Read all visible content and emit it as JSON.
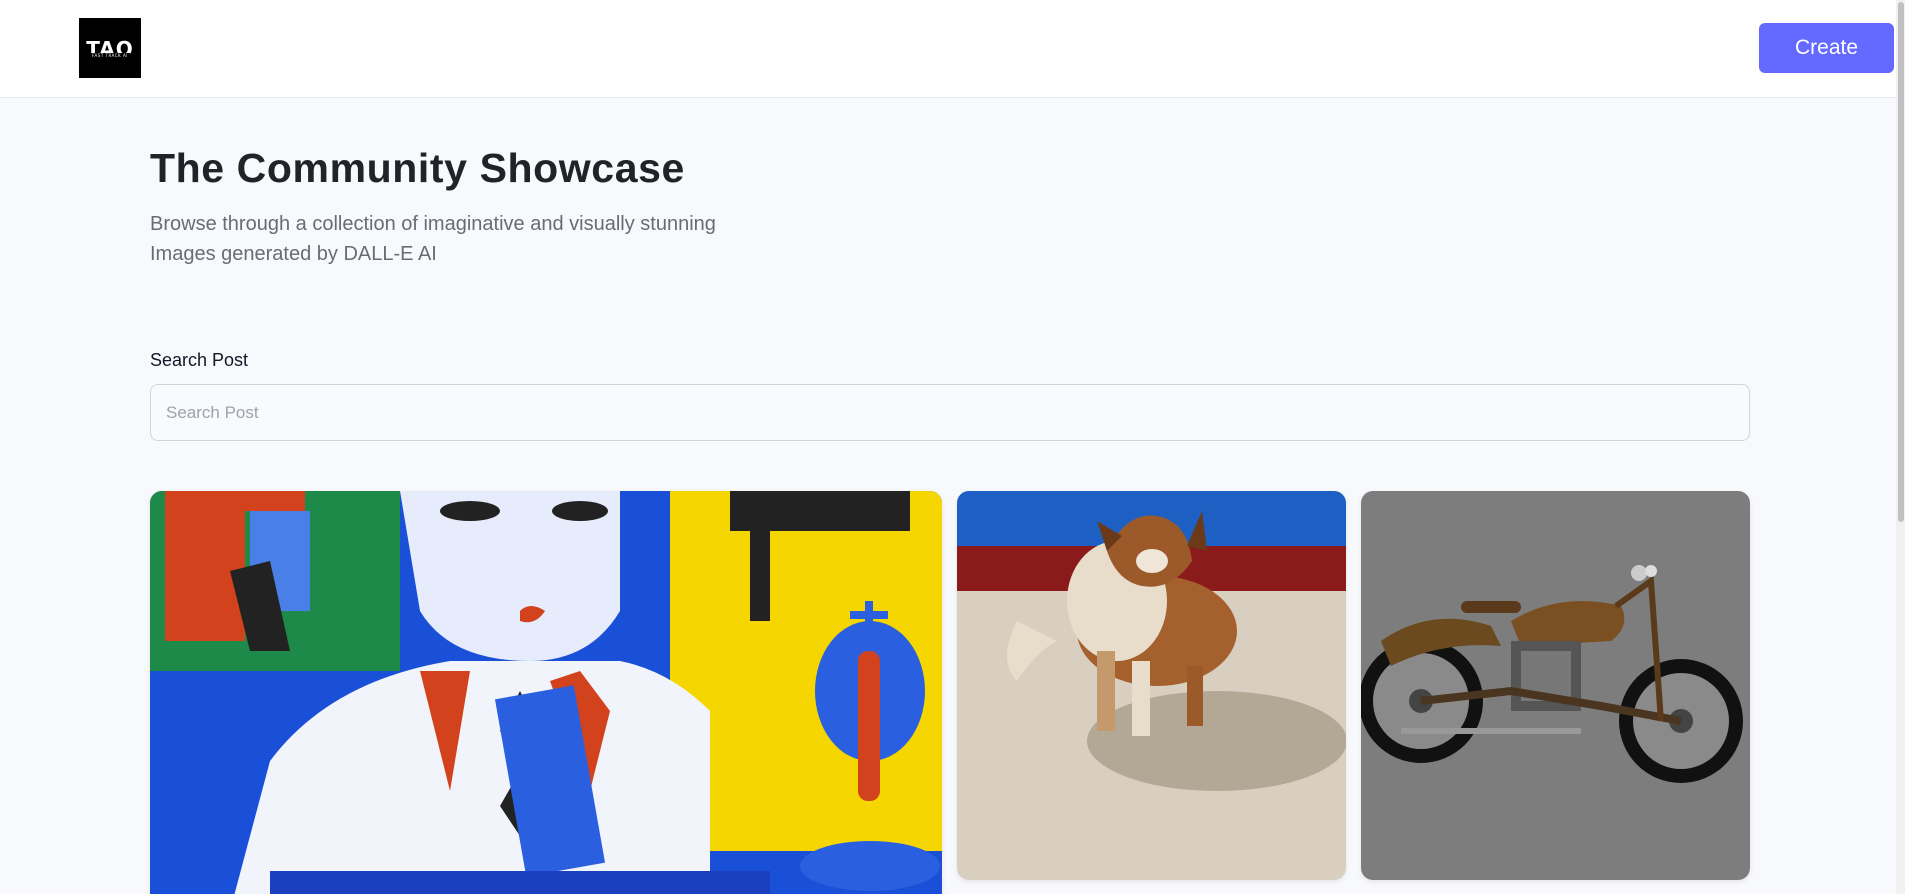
{
  "header": {
    "logo_text": "TAO",
    "logo_subtext": "FAST TRACK AI",
    "create_label": "Create"
  },
  "main": {
    "title": "The Community Showcase",
    "subtitle": "Browse through a collection of imaginative and visually stunning Images generated by DALL-E AI",
    "search": {
      "label": "Search Post",
      "placeholder": "Search Post",
      "value": ""
    },
    "cards": [
      {
        "name": "cubist-portrait-image"
      },
      {
        "name": "dog-image"
      },
      {
        "name": "motorcycle-image"
      }
    ]
  },
  "colors": {
    "accent": "#6469ff",
    "background": "#f8f9fc",
    "title": "#222328",
    "subtitle": "#666e75"
  }
}
